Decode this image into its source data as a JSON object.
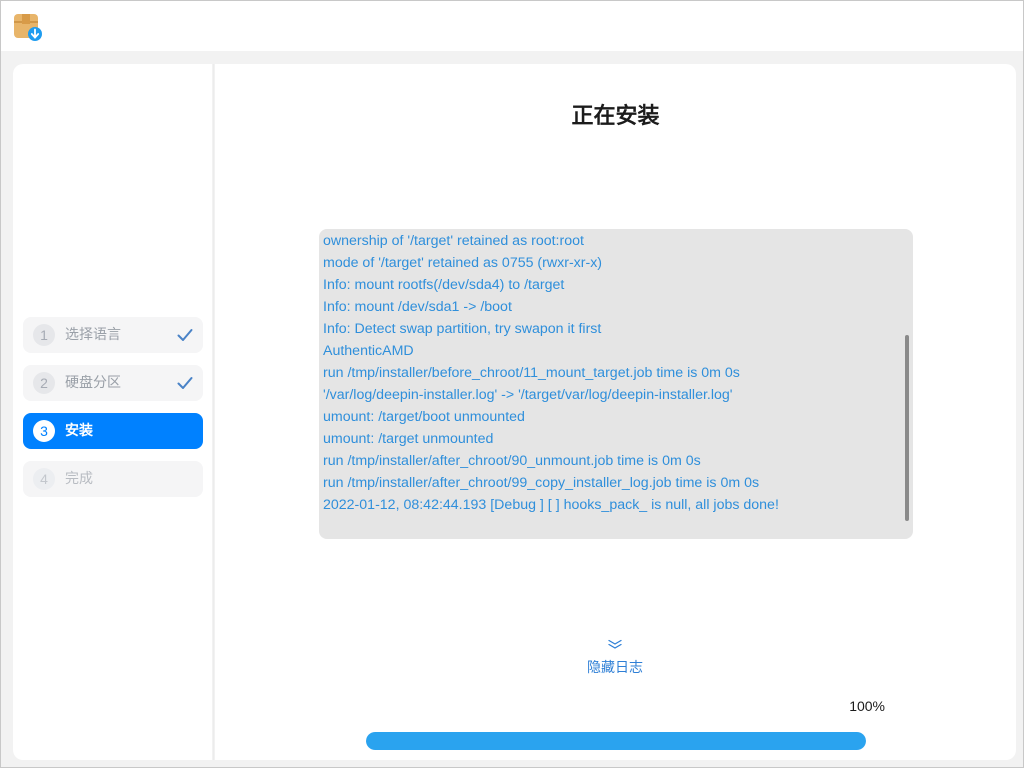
{
  "window": {
    "app_icon": "installer-package-icon"
  },
  "sidebar": {
    "steps": [
      {
        "number": "1",
        "label": "选择语言",
        "state": "done"
      },
      {
        "number": "2",
        "label": "硬盘分区",
        "state": "done"
      },
      {
        "number": "3",
        "label": "安装",
        "state": "active"
      },
      {
        "number": "4",
        "label": "完成",
        "state": "pending"
      }
    ]
  },
  "main": {
    "title": "正在安装",
    "log_lines": [
      "ownership of '/target' retained as root:root",
      "mode of '/target' retained as 0755 (rwxr-xr-x)",
      "Info: mount rootfs(/dev/sda4) to /target",
      "Info: mount /dev/sda1 -> /boot",
      "Info: Detect swap partition, try swapon it first",
      "AuthenticAMD",
      "run /tmp/installer/before_chroot/11_mount_target.job time is 0m 0s",
      "'/var/log/deepin-installer.log' -> '/target/var/log/deepin-installer.log'",
      "umount: /target/boot unmounted",
      "umount: /target unmounted",
      "run /tmp/installer/after_chroot/90_unmount.job time is 0m 0s",
      "run /tmp/installer/after_chroot/99_copy_installer_log.job time is 0m 0s",
      "2022-01-12, 08:42:44.193 [Debug  ] [  ] hooks_pack_ is null, all jobs done!"
    ],
    "toggle_log_label": "隐藏日志",
    "toggle_log_icon": "double-chevron-down-icon",
    "progress_text": "100%",
    "progress_fraction": 1.0
  },
  "colors": {
    "accent": "#0081ff",
    "log_text": "#2f8fdb",
    "progress": "#2aa3ef",
    "log_background": "#e5e5e5"
  }
}
